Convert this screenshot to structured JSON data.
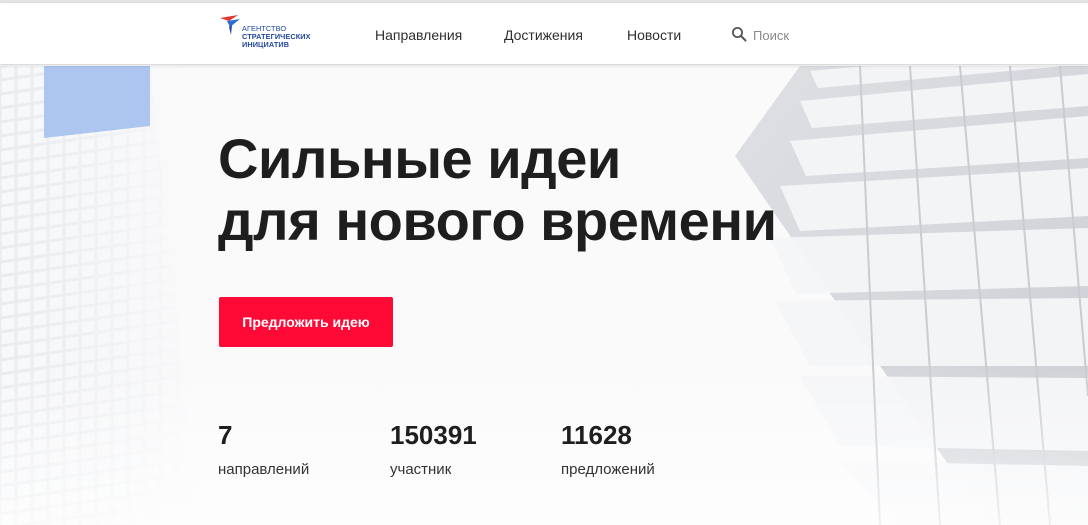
{
  "header": {
    "logo": {
      "lines": [
        "Агентство",
        "стратегических",
        "инициатив"
      ],
      "colors": {
        "text": "#21489a",
        "red": "#e8342f",
        "blue": "#2e6fd6"
      }
    },
    "nav": [
      {
        "label": "Направления"
      },
      {
        "label": "Достижения"
      },
      {
        "label": "Новости"
      }
    ],
    "search": {
      "placeholder": "Поиск",
      "icon": "search-icon"
    }
  },
  "hero": {
    "title_lines": [
      "Сильные идеи",
      "для нового времени"
    ],
    "cta_label": "Предложить идею",
    "stats": [
      {
        "value": "7",
        "label": "направлений"
      },
      {
        "value": "150391",
        "label": "участник"
      },
      {
        "value": "11628",
        "label": "предложений"
      }
    ]
  },
  "colors": {
    "accent": "#ff0a37",
    "text": "#1e1e1e",
    "header_bg": "#ffffff"
  }
}
